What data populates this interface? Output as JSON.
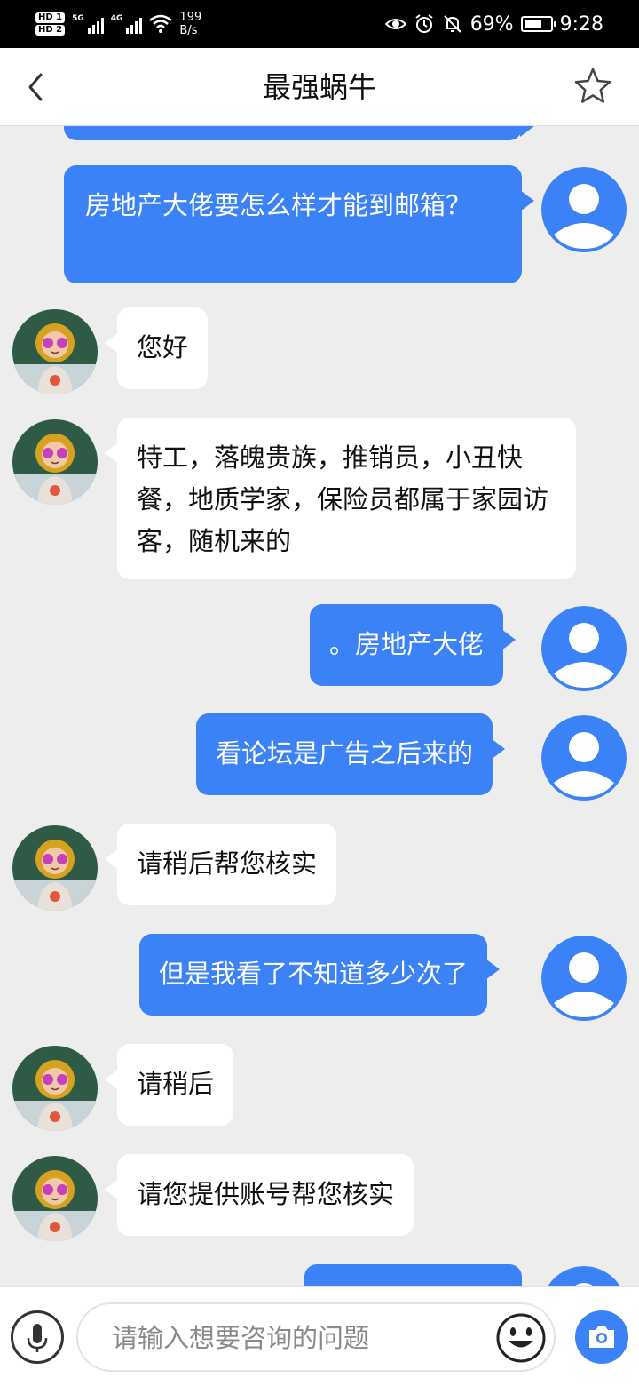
{
  "status_bar": {
    "hd1": "HD 1",
    "hd2": "HD 2",
    "net1": "5G",
    "net2": "4G",
    "rate_value": "199",
    "rate_unit": "B/s",
    "battery_percent": "69%",
    "battery_level": 0.69,
    "time": "9:28"
  },
  "header": {
    "title": "最强蜗牛"
  },
  "messages": [
    {
      "from": "user",
      "text": ""
    },
    {
      "from": "user",
      "text": "房地产大佬要怎么样才能到邮箱？"
    },
    {
      "from": "agent",
      "text": "您好"
    },
    {
      "from": "agent",
      "text": "特工，落魄贵族，推销员，小丑快餐，地质学家，保险员都属于家园访客，随机来的"
    },
    {
      "from": "user",
      "text": "。房地产大佬"
    },
    {
      "from": "user",
      "text": "看论坛是广告之后来的"
    },
    {
      "from": "agent",
      "text": "请稍后帮您核实"
    },
    {
      "from": "user",
      "text": "但是我看了不知道多少次了"
    },
    {
      "from": "agent",
      "text": "请稍后"
    },
    {
      "from": "agent",
      "text": "请您提供账号帮您核实"
    },
    {
      "from": "user",
      "text": ""
    }
  ],
  "input": {
    "placeholder": "请输入想要咨询的问题",
    "value": ""
  },
  "colors": {
    "accent": "#3b82f6",
    "background": "#ededed",
    "bubble_in": "#ffffff"
  },
  "icons": {
    "back": "chevron-left-icon",
    "favorite": "star-icon",
    "mic": "microphone-icon",
    "emoji": "smiley-icon",
    "camera": "camera-icon",
    "avatar_user": "default-user-icon"
  }
}
